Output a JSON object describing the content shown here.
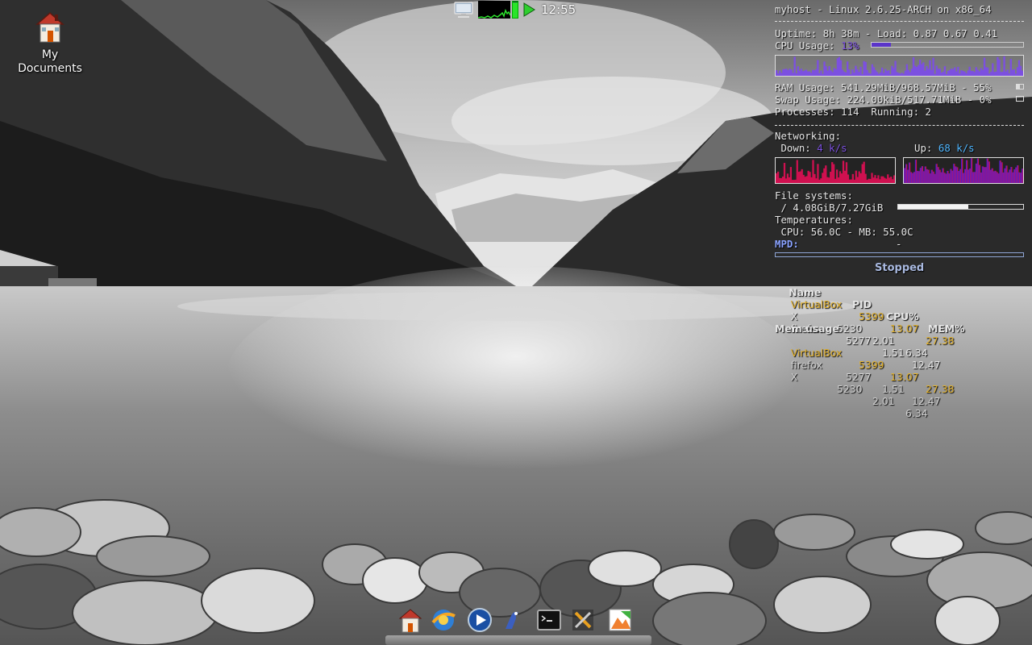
{
  "desktop": {
    "icons": [
      {
        "label_line1": "My",
        "label_line2": "Documents",
        "icon": "home-folder-icon"
      }
    ]
  },
  "panel": {
    "clock": "12:55",
    "cpu_meter_level": 0.95,
    "icons": [
      "monitor-icon",
      "cpu-graph",
      "play-icon"
    ]
  },
  "conky": {
    "header": "myhost - Linux 2.6.25-ARCH on x86_64",
    "uptime_label": "Uptime:",
    "uptime": "8h 38m",
    "load_label": "- Load:",
    "load": "0.87 0.67 0.41",
    "cpu_label": "CPU Usage:",
    "cpu_value": "13%",
    "cpu_percent": 13,
    "ram_line": "RAM Usage: 541.29MiB/968.57MiB - 55%",
    "ram_percent": 55,
    "swap_line": "Swap Usage: 224.00kiB/517.71MiB - 0%",
    "swap_percent": 0,
    "processes_line": "Processes: 114  Running: 2",
    "net_label": "Networking:",
    "down_label": " Down:",
    "down_value": "4 k/s",
    "up_label": "Up:",
    "up_value": "68 k/s",
    "fs_label": "File systems:",
    "fs_line": " / 4.08GiB/7.27GiB",
    "fs_percent": 56,
    "temps_label": "Temperatures:",
    "temps_line": " CPU: 56.0C - MB: 55.0C",
    "mpd_label": "MPD:",
    "mpd_value": "-",
    "mpd_status": "Stopped",
    "cpu_table": {
      "headers": [
        "Name",
        "PID",
        "CPU%",
        "MEM%"
      ],
      "rows": [
        {
          "name": "VirtualBox",
          "pid": "5399",
          "cpu": "13.07",
          "mem": "27.38"
        },
        {
          "name": "X",
          "pid": "5230",
          "cpu": "2.01",
          "mem": "6.34"
        },
        {
          "name": "firefox",
          "pid": "5277",
          "cpu": "1.51",
          "mem": "12.47"
        }
      ]
    },
    "mem_table": {
      "title": "Mem usage",
      "rows": [
        {
          "name": "VirtualBox",
          "pid": "5399",
          "cpu": "13.07",
          "mem": "27.38"
        },
        {
          "name": "firefox",
          "pid": "5277",
          "cpu": "1.51",
          "mem": "12.47"
        },
        {
          "name": "X",
          "pid": "5230",
          "cpu": "2.01",
          "mem": "6.34"
        }
      ]
    },
    "colors": {
      "purple": "#7c50e0",
      "cyan": "#4fb6ff",
      "gold": "#e2b12c",
      "down_graph": "#d01050",
      "up_graph_from": "#2020ff",
      "up_graph_to": "#ff1020"
    }
  },
  "dock": {
    "items": [
      "home-icon",
      "browser-icon",
      "media-player-icon",
      "pidgin-icon",
      "terminal-icon",
      "tools-icon",
      "image-viewer-icon"
    ]
  }
}
